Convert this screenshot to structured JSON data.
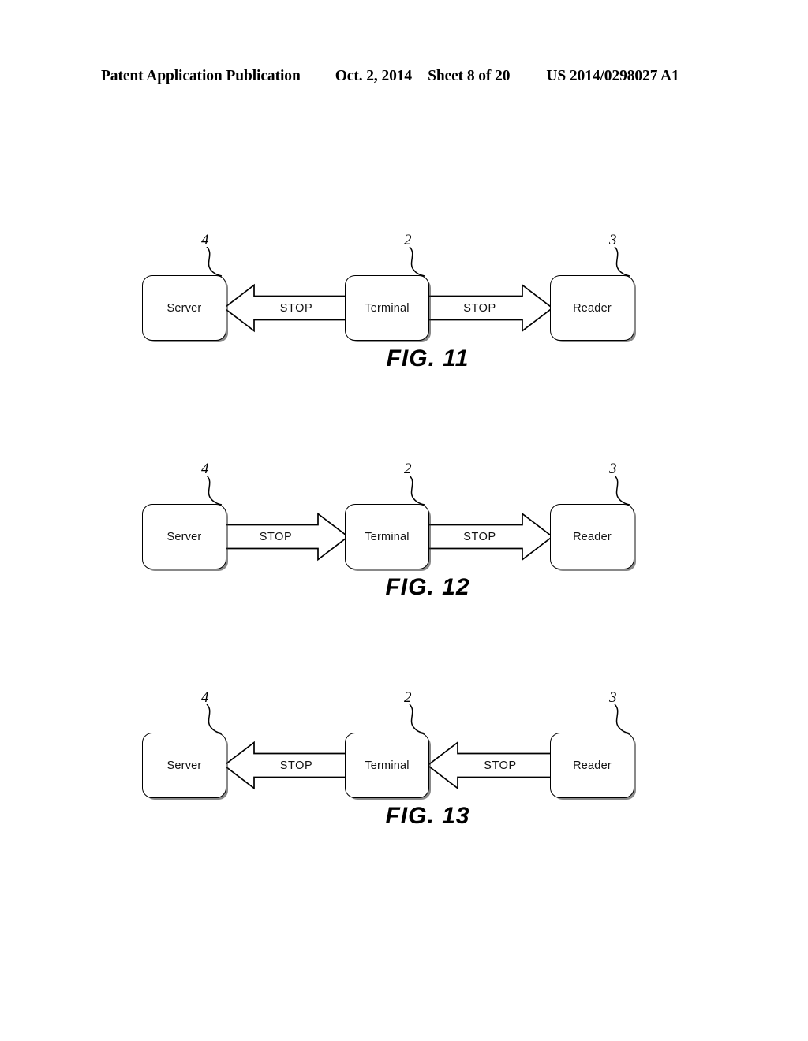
{
  "header": {
    "publication": "Patent Application Publication",
    "date": "Oct. 2, 2014",
    "sheet": "Sheet 8 of 20",
    "pub_number": "US 2014/0298027 A1"
  },
  "colors": {
    "ink": "#000000",
    "paper": "#ffffff",
    "shadow": "#282828"
  },
  "figures": [
    {
      "caption": "FIG. 11",
      "nodes": [
        {
          "label": "Server",
          "ref": "4",
          "position": "left"
        },
        {
          "label": "Terminal",
          "ref": "2",
          "position": "center"
        },
        {
          "label": "Reader",
          "ref": "3",
          "position": "right"
        }
      ],
      "arrows": [
        {
          "label": "STOP",
          "direction": "left",
          "segment": "a",
          "from": "Terminal",
          "to": "Server"
        },
        {
          "label": "STOP",
          "direction": "right",
          "segment": "b",
          "from": "Terminal",
          "to": "Reader"
        }
      ]
    },
    {
      "caption": "FIG. 12",
      "nodes": [
        {
          "label": "Server",
          "ref": "4",
          "position": "left"
        },
        {
          "label": "Terminal",
          "ref": "2",
          "position": "center"
        },
        {
          "label": "Reader",
          "ref": "3",
          "position": "right"
        }
      ],
      "arrows": [
        {
          "label": "STOP",
          "direction": "right",
          "segment": "a",
          "from": "Server",
          "to": "Terminal"
        },
        {
          "label": "STOP",
          "direction": "right",
          "segment": "b",
          "from": "Terminal",
          "to": "Reader"
        }
      ]
    },
    {
      "caption": "FIG. 13",
      "nodes": [
        {
          "label": "Server",
          "ref": "4",
          "position": "left"
        },
        {
          "label": "Terminal",
          "ref": "2",
          "position": "center"
        },
        {
          "label": "Reader",
          "ref": "3",
          "position": "right"
        }
      ],
      "arrows": [
        {
          "label": "STOP",
          "direction": "left",
          "segment": "a",
          "from": "Terminal",
          "to": "Server"
        },
        {
          "label": "STOP",
          "direction": "left",
          "segment": "b",
          "from": "Reader",
          "to": "Terminal"
        }
      ]
    }
  ]
}
